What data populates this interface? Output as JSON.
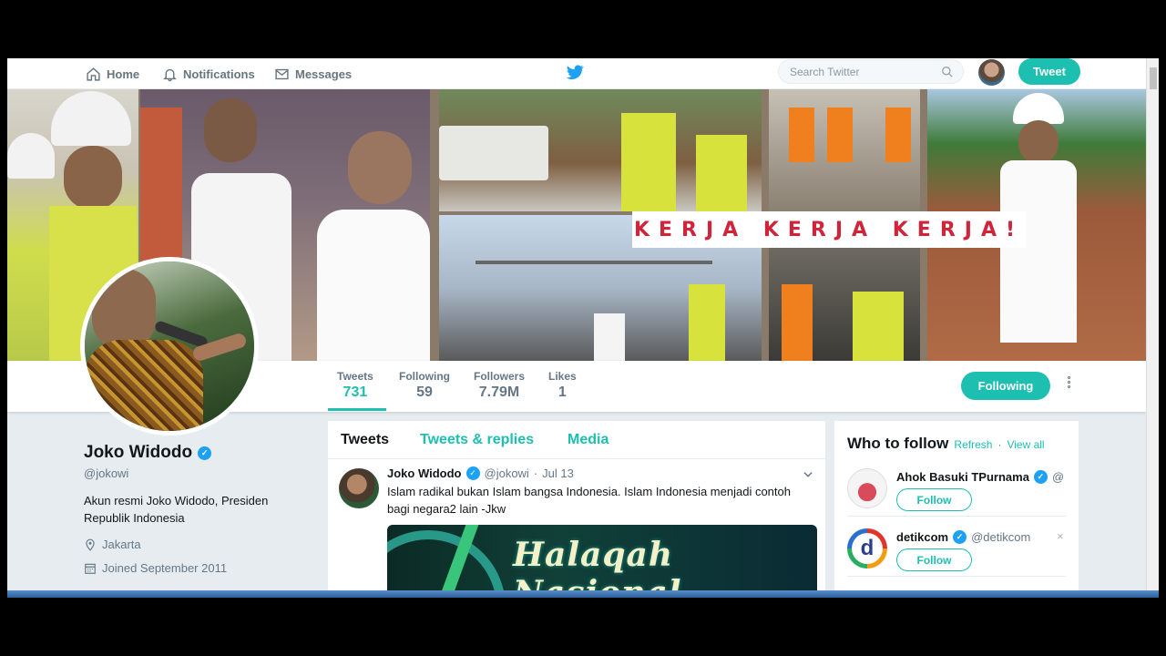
{
  "nav": {
    "home": "Home",
    "notifications": "Notifications",
    "messages": "Messages",
    "search_placeholder": "Search Twitter",
    "tweet_button": "Tweet"
  },
  "banner": {
    "slogan": "KERJA KERJA KERJA!"
  },
  "profile_nav": {
    "stats": [
      {
        "label": "Tweets",
        "value": "731"
      },
      {
        "label": "Following",
        "value": "59"
      },
      {
        "label": "Followers",
        "value": "7.79M"
      },
      {
        "label": "Likes",
        "value": "1"
      }
    ],
    "following_button": "Following"
  },
  "profile": {
    "name": "Joko Widodo",
    "handle": "@jokowi",
    "bio": "Akun resmi Joko Widodo, Presiden Republik Indonesia",
    "location": "Jakarta",
    "joined": "Joined September 2011"
  },
  "timeline": {
    "tabs": [
      "Tweets",
      "Tweets & replies",
      "Media"
    ],
    "tweet": {
      "name": "Joko Widodo",
      "handle": "@jokowi",
      "separator": "·",
      "date": "Jul 13",
      "text": "Islam radikal bukan Islam bangsa Indonesia. Islam Indonesia menjadi contoh bagi negara2 lain -Jkw",
      "media_title": "Halaqah Nasional"
    }
  },
  "who_to_follow": {
    "title": "Who to follow",
    "refresh": "Refresh",
    "separator": "·",
    "view_all": "View all",
    "suggestions": [
      {
        "name": "Ahok Basuki TPurnama",
        "handle": "@",
        "follow": "Follow",
        "close": "×"
      },
      {
        "name": "detikcom",
        "handle": "@detikcom",
        "follow": "Follow",
        "close": "×",
        "avatar_letter": "d"
      }
    ]
  },
  "colors": {
    "accent": "#1dbfb0",
    "verified": "#1da1f2",
    "kerja_red": "#d0243a"
  }
}
